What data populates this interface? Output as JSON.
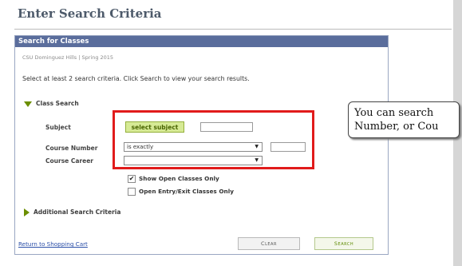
{
  "page": {
    "title": "Enter Search Criteria"
  },
  "panel": {
    "header": "Search for Classes",
    "crumb": "CSU Dominguez Hills | Spring 2015",
    "instructions": "Select at least 2 search criteria. Click Search to view your search results."
  },
  "class_search": {
    "section_label": "Class Search",
    "subject_label": "Subject",
    "select_subject_button": "select subject",
    "subject_value": "",
    "course_number_label": "Course Number",
    "course_number_operator": "is exactly",
    "course_number_value": "",
    "course_career_label": "Course Career",
    "course_career_value": "",
    "show_open_label": "Show Open Classes Only",
    "show_open_checked": true,
    "open_entry_label": "Open Entry/Exit Classes Only",
    "open_entry_checked": false
  },
  "additional": {
    "label": "Additional Search Criteria"
  },
  "footer": {
    "return_link": "Return to Shopping Cart",
    "clear_button": "Clear",
    "search_button": "Search"
  },
  "callout": {
    "line1": "You can search",
    "line2": "Number, or Cou"
  },
  "colors": {
    "accent_red": "#e11b1b",
    "header_blue": "#5a6d9c",
    "green": "#6b8e00"
  },
  "icons": {
    "expand_down": "triangle-down-icon",
    "expand_right": "triangle-right-icon",
    "dropdown": "chevron-down-icon"
  }
}
